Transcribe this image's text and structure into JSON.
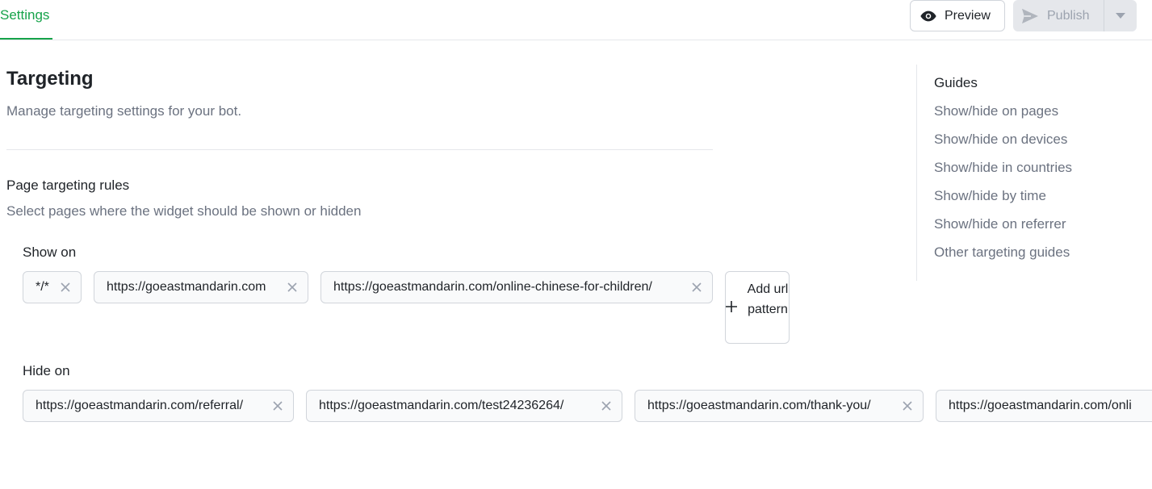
{
  "header": {
    "tab_label": "Settings",
    "preview_label": "Preview",
    "publish_label": "Publish",
    "accent_color": "#16a34a"
  },
  "main": {
    "title": "Targeting",
    "subtitle": "Manage targeting settings for your bot.",
    "section_title": "Page targeting rules",
    "section_subtitle": "Select pages where the widget should be shown or hidden",
    "show_on": {
      "label": "Show on",
      "chips": [
        "*/*",
        "https://goeastmandarin.com",
        "https://goeastmandarin.com/online-chinese-for-children/"
      ],
      "add_label": "Add url pattern"
    },
    "hide_on": {
      "label": "Hide on",
      "chips": [
        "https://goeastmandarin.com/referral/",
        "https://goeastmandarin.com/test24236264/",
        "https://goeastmandarin.com/thank-you/",
        "https://goeastmandarin.com/onli"
      ]
    }
  },
  "guides": {
    "title": "Guides",
    "links": [
      "Show/hide on pages",
      "Show/hide on devices",
      "Show/hide in countries",
      "Show/hide by time",
      "Show/hide on referrer",
      "Other targeting guides"
    ]
  },
  "icons": {
    "preview": "eye-icon",
    "publish": "send-icon",
    "publish_menu": "caret-down-icon",
    "remove": "close-icon",
    "add": "plus-icon"
  }
}
